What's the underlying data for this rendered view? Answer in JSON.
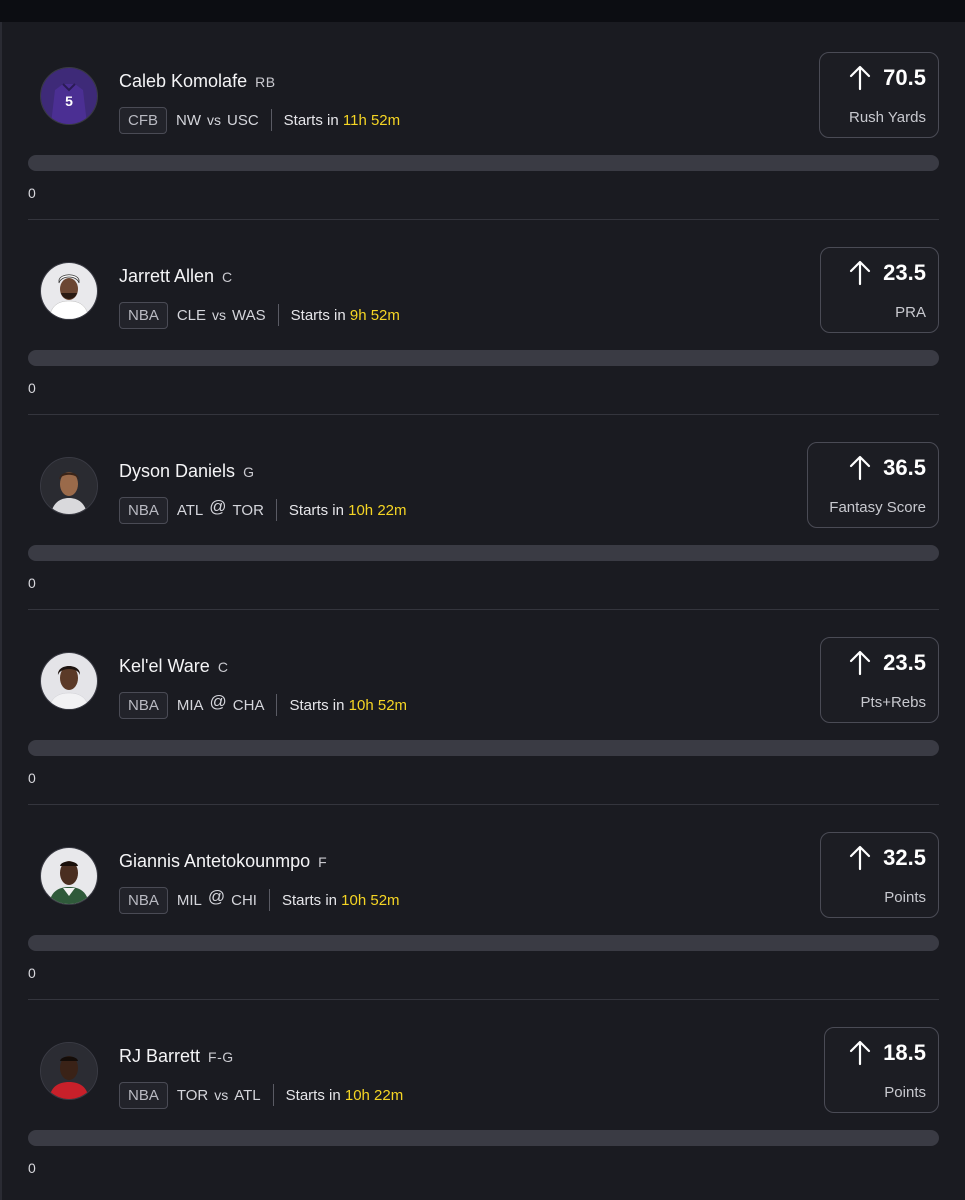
{
  "colors": {
    "background": "#1a1b21",
    "accent_time": "#f5d524",
    "track": "#3a3b44"
  },
  "picks": [
    {
      "name": "Caleb Komolafe",
      "position": "RB",
      "league": "CFB",
      "team": "NW",
      "separator": "vs",
      "opponent": "USC",
      "starts_label": "Starts in",
      "starts_time": "11h 52m",
      "line_value": "70.5",
      "stat": "Rush Yards",
      "direction_icon": "arrow-up-icon",
      "progress": 0,
      "progress_label": "0"
    },
    {
      "name": "Jarrett Allen",
      "position": "C",
      "league": "NBA",
      "team": "CLE",
      "separator": "vs",
      "opponent": "WAS",
      "starts_label": "Starts in",
      "starts_time": "9h 52m",
      "line_value": "23.5",
      "stat": "PRA",
      "direction_icon": "arrow-up-icon",
      "progress": 0,
      "progress_label": "0"
    },
    {
      "name": "Dyson Daniels",
      "position": "G",
      "league": "NBA",
      "team": "ATL",
      "separator": "@",
      "opponent": "TOR",
      "starts_label": "Starts in",
      "starts_time": "10h 22m",
      "line_value": "36.5",
      "stat": "Fantasy Score",
      "direction_icon": "arrow-up-icon",
      "progress": 0,
      "progress_label": "0"
    },
    {
      "name": "Kel'el Ware",
      "position": "C",
      "league": "NBA",
      "team": "MIA",
      "separator": "@",
      "opponent": "CHA",
      "starts_label": "Starts in",
      "starts_time": "10h 52m",
      "line_value": "23.5",
      "stat": "Pts+Rebs",
      "direction_icon": "arrow-up-icon",
      "progress": 0,
      "progress_label": "0"
    },
    {
      "name": "Giannis Antetokounmpo",
      "position": "F",
      "league": "NBA",
      "team": "MIL",
      "separator": "@",
      "opponent": "CHI",
      "starts_label": "Starts in",
      "starts_time": "10h 52m",
      "line_value": "32.5",
      "stat": "Points",
      "direction_icon": "arrow-up-icon",
      "progress": 0,
      "progress_label": "0"
    },
    {
      "name": "RJ Barrett",
      "position": "F-G",
      "league": "NBA",
      "team": "TOR",
      "separator": "vs",
      "opponent": "ATL",
      "starts_label": "Starts in",
      "starts_time": "10h 22m",
      "line_value": "18.5",
      "stat": "Points",
      "direction_icon": "arrow-up-icon",
      "progress": 0,
      "progress_label": "0"
    }
  ]
}
